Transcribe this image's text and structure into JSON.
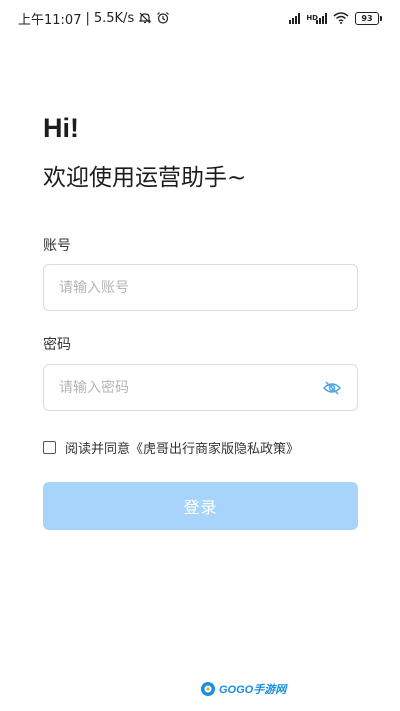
{
  "status_bar": {
    "time": "上午11:07",
    "separator": "|",
    "network_speed": "5.5K/s",
    "battery": "93",
    "hd_label": "HD",
    "icons": [
      "mute-icon",
      "alarm-icon",
      "signal-icon",
      "hd-signal-icon",
      "wifi-icon",
      "battery-icon"
    ]
  },
  "greeting": {
    "hi": "Hi!",
    "welcome": "欢迎使用运营助手~"
  },
  "account": {
    "label": "账号",
    "value": "",
    "placeholder": "请输入账号"
  },
  "password": {
    "label": "密码",
    "value": "",
    "placeholder": "请输入密码",
    "toggle_icon": "eye-hidden-icon"
  },
  "agreement": {
    "checked": false,
    "text": "阅读并同意《虎哥出行商家版隐私政策》"
  },
  "login_button": {
    "label": "登录"
  },
  "colors": {
    "primary": "#a8d4fb",
    "eye_icon": "#4aa3e6",
    "watermark": "#1a8fe0"
  },
  "watermark": {
    "text": "GOGO手游网"
  }
}
